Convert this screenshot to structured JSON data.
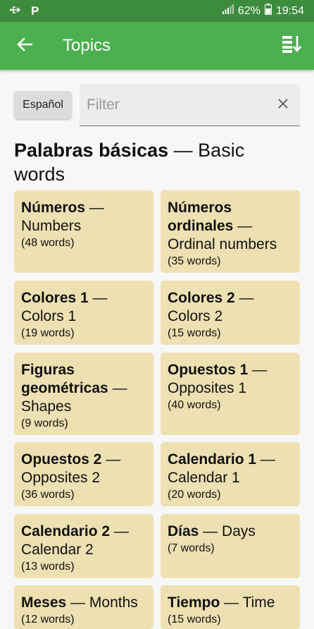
{
  "status_bar": {
    "battery_percent": "62%",
    "time": "19:54"
  },
  "app_bar": {
    "title": "Topics"
  },
  "filter": {
    "language_button": "Español",
    "placeholder": "Filter"
  },
  "section": {
    "native": "Palabras básicas",
    "separator": " — ",
    "english": "Basic words"
  },
  "topics": [
    {
      "native": "Números",
      "english": "Numbers",
      "count": "(48 words)"
    },
    {
      "native": "Números ordinales",
      "english": "Ordinal numbers",
      "count": "(35 words)"
    },
    {
      "native": "Colores 1",
      "english": "Colors 1",
      "count": "(19 words)"
    },
    {
      "native": "Colores 2",
      "english": "Colors 2",
      "count": "(15 words)"
    },
    {
      "native": "Figuras geométricas",
      "english": "Shapes",
      "count": "(9 words)"
    },
    {
      "native": "Opuestos 1",
      "english": "Opposites 1",
      "count": "(40 words)"
    },
    {
      "native": "Opuestos 2",
      "english": "Opposites 2",
      "count": "(36 words)"
    },
    {
      "native": "Calendario 1",
      "english": "Calendar 1",
      "count": "(20 words)"
    },
    {
      "native": "Calendario 2",
      "english": "Calendar 2",
      "count": "(13 words)"
    },
    {
      "native": "Días",
      "english": "Days",
      "count": "(7 words)"
    },
    {
      "native": "Meses",
      "english": "Months",
      "count": "(12 words)"
    },
    {
      "native": "Tiempo",
      "english": "Time",
      "count": "(15 words)"
    }
  ],
  "colors": {
    "status_bar": "#3d8b3d",
    "app_bar": "#4caf50",
    "card": "#ede0b2",
    "background": "#f7f7f7"
  }
}
